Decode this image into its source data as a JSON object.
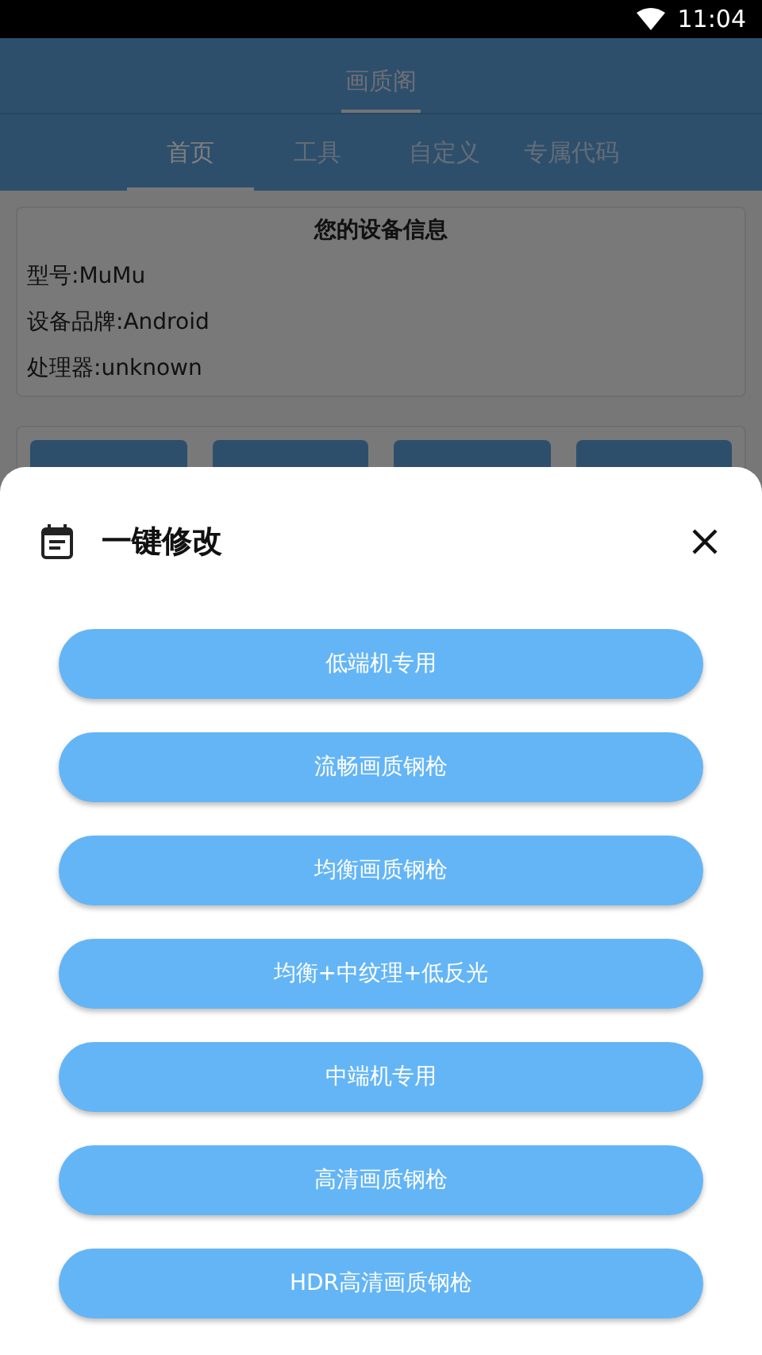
{
  "status_bar": {
    "time": "11:04"
  },
  "app_bar": {
    "title": "画质阁"
  },
  "tabs": [
    {
      "label": "首页",
      "selected": true
    },
    {
      "label": "工具",
      "selected": false
    },
    {
      "label": "自定义",
      "selected": false
    },
    {
      "label": "专属代码",
      "selected": false
    }
  ],
  "device_info": {
    "title": "您的设备信息",
    "lines": [
      "型号:MuMu",
      "设备品牌:Android",
      "处理器:unknown"
    ]
  },
  "sheet": {
    "title": "一键修改",
    "buttons": [
      "低端机专用",
      "流畅画质钢枪",
      "均衡画质钢枪",
      "均衡+中纹理+低反光",
      "中端机专用",
      "高清画质钢枪",
      "HDR高清画质钢枪"
    ]
  }
}
